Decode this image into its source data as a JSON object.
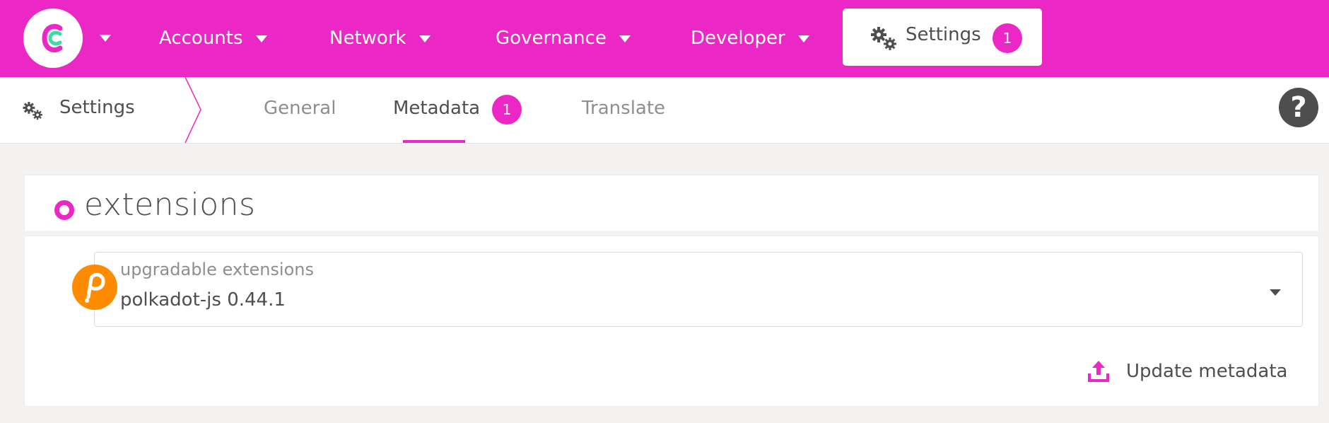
{
  "topbar": {
    "logo_name": "polkadot-apps-logo",
    "menu": [
      {
        "label": "Accounts"
      },
      {
        "label": "Network"
      },
      {
        "label": "Governance"
      },
      {
        "label": "Developer"
      }
    ],
    "active_menu": {
      "label": "Settings",
      "badge": "1"
    }
  },
  "subnav": {
    "section": "Settings",
    "tabs": [
      {
        "label": "General"
      },
      {
        "label": "Metadata",
        "badge": "1"
      },
      {
        "label": "Translate"
      }
    ],
    "active_tab": "Metadata",
    "help_label": "?"
  },
  "content": {
    "section_title": "extensions",
    "dropdown": {
      "label": "upgradable extensions",
      "value": "polkadot-js 0.44.1"
    },
    "update_button": "Update metadata"
  },
  "colors": {
    "accent": "#eb28c5",
    "extension_icon": "#ff8c00",
    "text": "#4e4e4e",
    "muted_text": "#8e8e8e",
    "background": "#f3f2f1"
  }
}
